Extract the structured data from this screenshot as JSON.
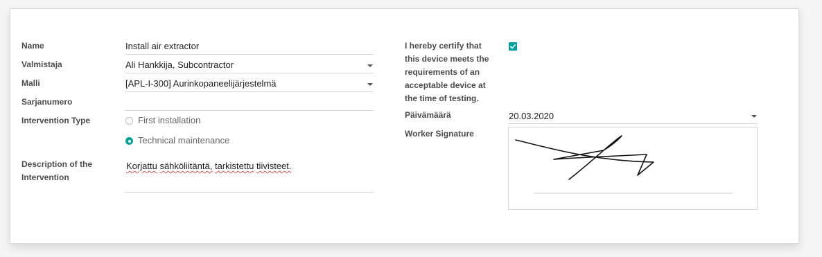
{
  "form": {
    "name": {
      "label": "Name",
      "value": "Install air extractor"
    },
    "manufacturer": {
      "label": "Valmistaja",
      "value": "Ali Hankkija, Subcontractor"
    },
    "model": {
      "label": "Malli",
      "value": "[APL-I-300] Aurinkopaneelijärjestelmä"
    },
    "serial": {
      "label": "Sarjanumero",
      "value": ""
    },
    "intervention_type": {
      "label": "Intervention Type",
      "options": [
        {
          "label": "First installation",
          "selected": false
        },
        {
          "label": "Technical maintenance",
          "selected": true
        }
      ]
    },
    "description": {
      "label_line1": "Description of the",
      "label_line2": "Intervention",
      "words": [
        "Korjattu",
        "sähköliitäntä,",
        "tarkistettu",
        "tiivisteet."
      ]
    },
    "certify": {
      "label_lines": [
        "I hereby certify that",
        "this device meets the",
        "requirements of an",
        "acceptable device at",
        "the time of testing."
      ],
      "checked": true
    },
    "date": {
      "label": "Päivämäärä",
      "value": "20.03.2020"
    },
    "signature": {
      "label": "Worker Signature"
    }
  },
  "colors": {
    "accent": "#00a09d",
    "label": "#4c4c4c",
    "border": "#d6d6d6",
    "spellcheck": "#d9534f"
  }
}
